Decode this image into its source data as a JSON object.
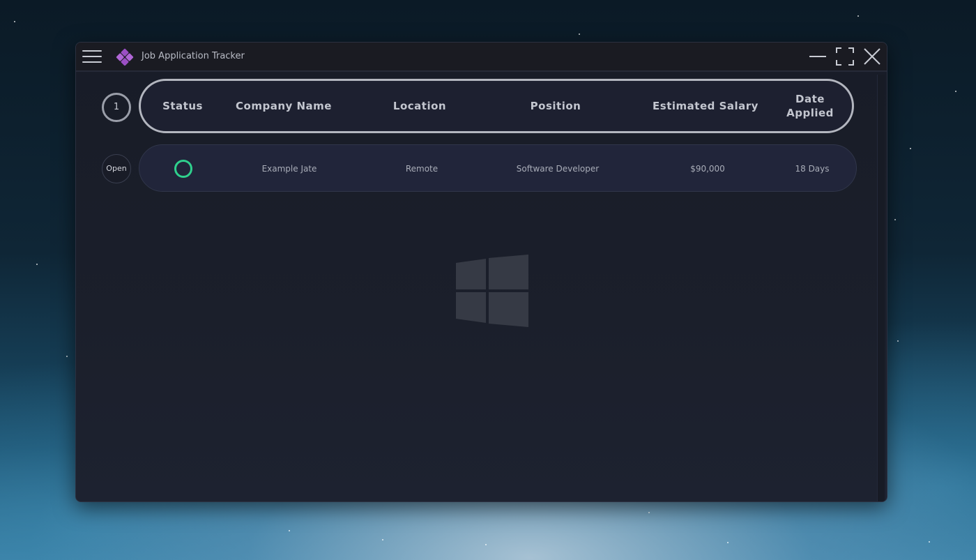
{
  "app": {
    "title": "Job Application Tracker"
  },
  "summary": {
    "count": "1"
  },
  "table": {
    "headers": {
      "status": "Status",
      "company": "Company Name",
      "location": "Location",
      "position": "Position",
      "salary": "Estimated Salary",
      "date_line1": "Date",
      "date_line2": "Applied"
    },
    "rows": [
      {
        "action": "Open",
        "status": "active",
        "company": "Example Jate",
        "location": "Remote",
        "position": "Software Developer",
        "salary": "$90,000",
        "date": "18 Days"
      }
    ]
  },
  "colors": {
    "status_active": "#2fd08d",
    "logo": "#9b4fc4",
    "background": "#1b1f2b"
  },
  "icons": {
    "menu": "hamburger-menu-icon",
    "logo": "diamond-grid-logo",
    "minimize": "minimize-icon",
    "maximize": "fullscreen-icon",
    "close": "close-icon",
    "watermark": "windows-logo"
  }
}
